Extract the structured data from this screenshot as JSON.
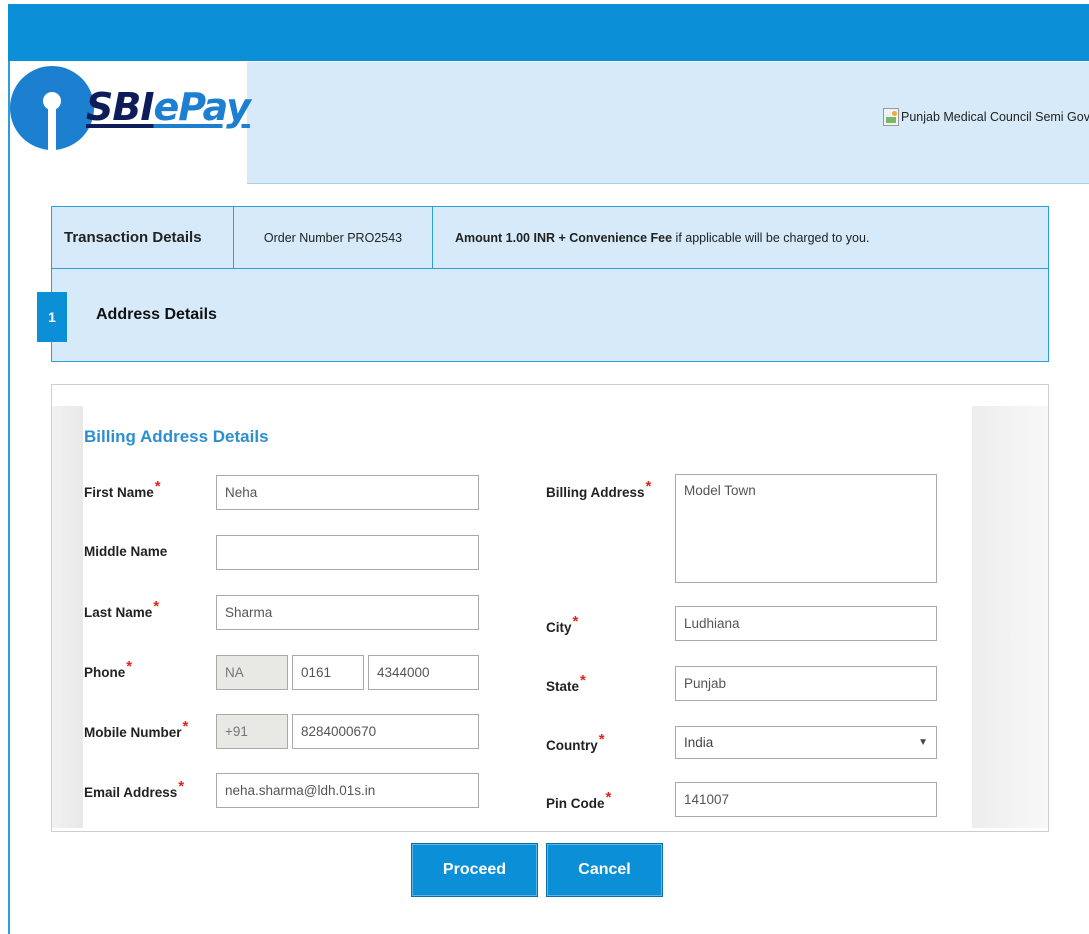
{
  "logo": {
    "sbi": "SBI",
    "epay": "ePay"
  },
  "merchant_logo_alt": "Punjab Medical Council Semi Gov",
  "transaction": {
    "title": "Transaction Details",
    "order": "Order Number PRO2543",
    "amount_bold": "Amount 1.00 INR + Convenience Fee",
    "amount_rest": " if applicable will be charged to you."
  },
  "step": {
    "number": "1",
    "title": "Address Details"
  },
  "form": {
    "section_title": "Billing Address Details",
    "required_mark": "*",
    "labels": {
      "first_name": "First Name",
      "middle_name": "Middle Name",
      "last_name": "Last Name",
      "phone": "Phone",
      "mobile": "Mobile Number",
      "email": "Email Address",
      "billing_address": "Billing Address",
      "city": "City",
      "state": "State",
      "country": "Country",
      "pin": "Pin Code"
    },
    "values": {
      "first_name": "Neha",
      "middle_name": "",
      "last_name": "Sharma",
      "phone_country": "NA",
      "phone_area": "0161",
      "phone_number": "4344000",
      "mobile_code": "+91",
      "mobile_number": "8284000670",
      "email": "neha.sharma@ldh.01s.in",
      "billing_address": "Model Town",
      "city": "Ludhiana",
      "state": "Punjab",
      "country": "India",
      "pin": "141007"
    },
    "caret": "▼"
  },
  "buttons": {
    "proceed": "Proceed",
    "cancel": "Cancel"
  },
  "colors": {
    "brand_blue": "#0b8fd6",
    "panel": "#d6eaf9",
    "title_blue": "#2d8fd0",
    "required": "#e2231a"
  }
}
